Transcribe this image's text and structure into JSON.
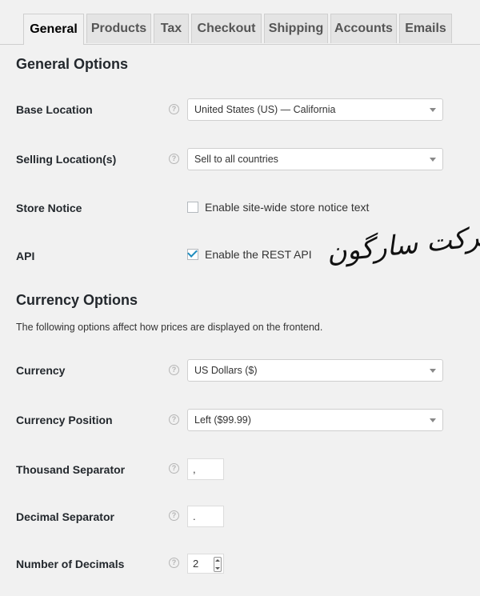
{
  "tabs": [
    {
      "label": "General",
      "active": true
    },
    {
      "label": "Products",
      "active": false
    },
    {
      "label": "Tax",
      "active": false
    },
    {
      "label": "Checkout",
      "active": false
    },
    {
      "label": "Shipping",
      "active": false
    },
    {
      "label": "Accounts",
      "active": false
    },
    {
      "label": "Emails",
      "active": false
    }
  ],
  "general_options": {
    "title": "General Options",
    "base_location": {
      "label": "Base Location",
      "value": "United States (US) — California"
    },
    "selling_locations": {
      "label": "Selling Location(s)",
      "value": "Sell to all countries"
    },
    "store_notice": {
      "label": "Store Notice",
      "checkbox_label": "Enable site-wide store notice text",
      "checked": false
    },
    "api": {
      "label": "API",
      "checkbox_label": "Enable the REST API",
      "checked": true
    }
  },
  "currency_options": {
    "title": "Currency Options",
    "description": "The following options affect how prices are displayed on the frontend.",
    "currency": {
      "label": "Currency",
      "value": "US Dollars ($)"
    },
    "currency_position": {
      "label": "Currency Position",
      "value": "Left ($99.99)"
    },
    "thousand_separator": {
      "label": "Thousand Separator",
      "value": ","
    },
    "decimal_separator": {
      "label": "Decimal Separator",
      "value": "."
    },
    "number_of_decimals": {
      "label": "Number of Decimals",
      "value": "2"
    }
  },
  "watermark": {
    "text": "شرکت سارگون"
  },
  "icons": {
    "help": "help-question-icon",
    "caret": "chevron-down-icon",
    "check": "checkmark-icon"
  },
  "colors": {
    "checkmark": "#1e8cbe",
    "background": "#f1f1f1",
    "tab_inactive": "#e4e4e4"
  }
}
